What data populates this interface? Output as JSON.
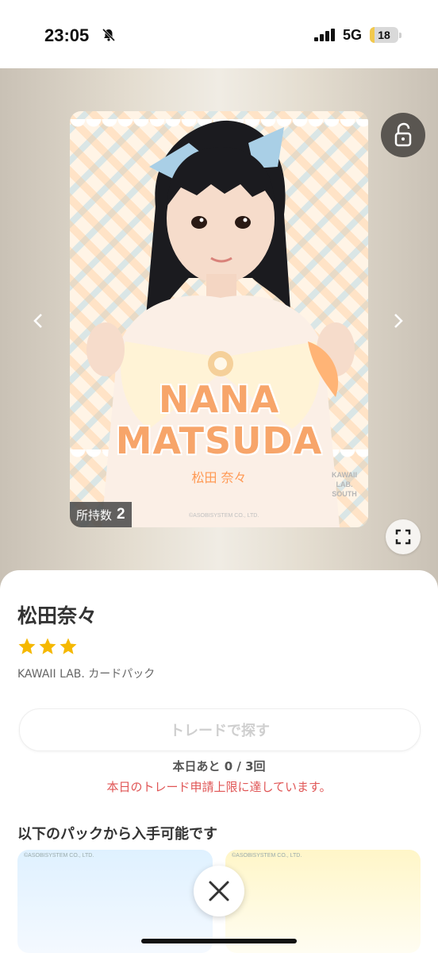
{
  "status_bar": {
    "time": "23:05",
    "network": "5G",
    "battery_level": "18",
    "battery_fraction": 0.18,
    "icons": [
      "bell-slash-icon",
      "signal-icon"
    ]
  },
  "card_viewer": {
    "card_name_line1": "NANA",
    "card_name_line2": "MATSUDA",
    "card_name_kana": "松田 奈々",
    "card_logo_lines": [
      "KAWAII",
      "LAB.",
      "SOUTH"
    ],
    "card_copyright": "©ASOBISYSTEM CO., LTD.",
    "owned_label": "所持数",
    "owned_count": "2",
    "icons": [
      "lock-open-icon",
      "chevron-left-icon",
      "chevron-right-icon",
      "expand-icon"
    ]
  },
  "sheet": {
    "title": "松田奈々",
    "rarity_stars": 3,
    "pack_name": "KAWAII LAB. カードパック",
    "trade_button_label": "トレードで探す",
    "remaining_text": "本日あと 0 / 3回",
    "limit_message": "本日のトレード申請上限に達しています。",
    "section_title": "以下のパックから入手可能です",
    "pack_copyrights": [
      "©ASOBISYSTEM CO., LTD.",
      "©ASOBISYSTEM CO., LTD."
    ]
  },
  "colors": {
    "accent_orange": "#f7a56a",
    "error_red": "#e05656",
    "star_yellow": "#f5b800"
  }
}
